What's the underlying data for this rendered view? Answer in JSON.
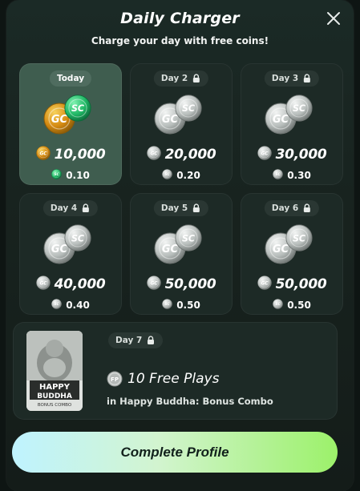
{
  "header": {
    "title": "Daily Charger",
    "subtitle": "Charge your day with free coins!",
    "close_icon": "close-icon"
  },
  "days": [
    {
      "label": "Today",
      "locked": false,
      "gc": "10,000",
      "sc": "0.10",
      "active": true
    },
    {
      "label": "Day 2",
      "locked": true,
      "gc": "20,000",
      "sc": "0.20",
      "active": false
    },
    {
      "label": "Day 3",
      "locked": true,
      "gc": "30,000",
      "sc": "0.30",
      "active": false
    },
    {
      "label": "Day 4",
      "locked": true,
      "gc": "40,000",
      "sc": "0.40",
      "active": false
    },
    {
      "label": "Day 5",
      "locked": true,
      "gc": "50,000",
      "sc": "0.50",
      "active": false
    },
    {
      "label": "Day 6",
      "locked": true,
      "gc": "50,000",
      "sc": "0.50",
      "active": false
    }
  ],
  "day7": {
    "label": "Day 7",
    "locked": true,
    "reward": "10 Free Plays",
    "subtitle": "in Happy Buddha: Bonus Combo",
    "fp_badge": "FP",
    "thumb_title": "HAPPY BUDDHA",
    "thumb_sub": "BONUS COMBO"
  },
  "coin_labels": {
    "gc": "GC",
    "sc": "SC"
  },
  "cta": {
    "label": "Complete Profile"
  },
  "colors": {
    "gold": "#e9a21c",
    "green": "#22c46b",
    "silver": "#c9cdcc",
    "cta_start": "#bff3ff",
    "cta_end": "#9cf16a"
  }
}
